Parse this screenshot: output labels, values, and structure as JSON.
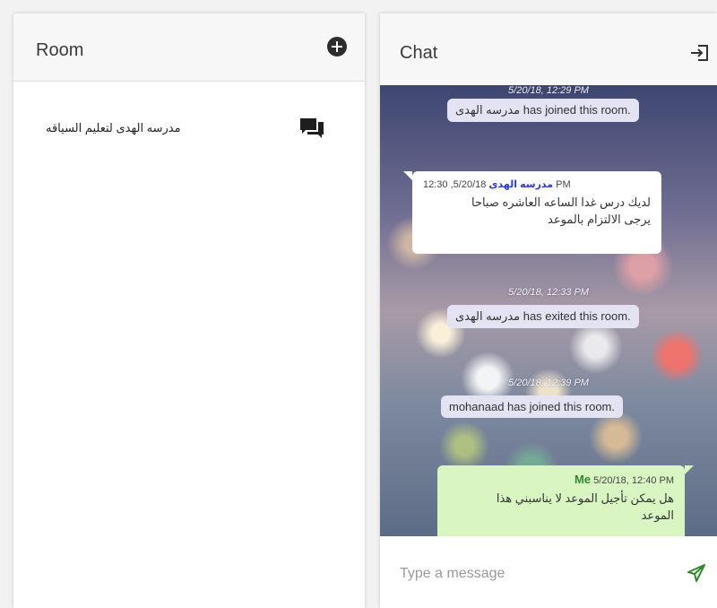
{
  "room_panel": {
    "title": "Room",
    "add_icon": "add-circle-icon",
    "rooms": [
      {
        "name": "مدرسه الهدى لتعليم السياقه",
        "icon": "chat-bubbles-icon"
      }
    ]
  },
  "chat_panel": {
    "title": "Chat",
    "exit_icon": "exit-room-icon",
    "messages": [
      {
        "type": "timestamp",
        "text": "5/20/18, 12:29 PM"
      },
      {
        "type": "system",
        "text": "مدرسه الهدى has joined this room."
      },
      {
        "type": "incoming",
        "sender": "مدرسه الهدى",
        "time": "5/20/18, 12:30 PM",
        "lines": [
          "لديك درس غدا الساعه العاشره صباحا",
          "يرجى الالتزام بالموعد"
        ]
      },
      {
        "type": "timestamp",
        "text": "5/20/18, 12:33 PM"
      },
      {
        "type": "system",
        "text": "مدرسه الهدى has exited this room."
      },
      {
        "type": "timestamp",
        "text": "5/20/18, 12:39 PM"
      },
      {
        "type": "system",
        "text": "mohanaad has joined this room."
      },
      {
        "type": "outgoing",
        "sender": "Me",
        "time": "5/20/18, 12:40 PM",
        "lines": [
          "هل يمكن تأجيل الموعد لا يناسبني هذا",
          "الموعد"
        ]
      }
    ],
    "input": {
      "placeholder": "Type a message",
      "value": ""
    },
    "send_icon": "send-icon"
  },
  "colors": {
    "incoming_sender": "#2a3ad6",
    "outgoing_sender": "#2f8a2f",
    "outgoing_bubble": "#d9f5c2",
    "system_bubble": "#e3e3f4"
  }
}
